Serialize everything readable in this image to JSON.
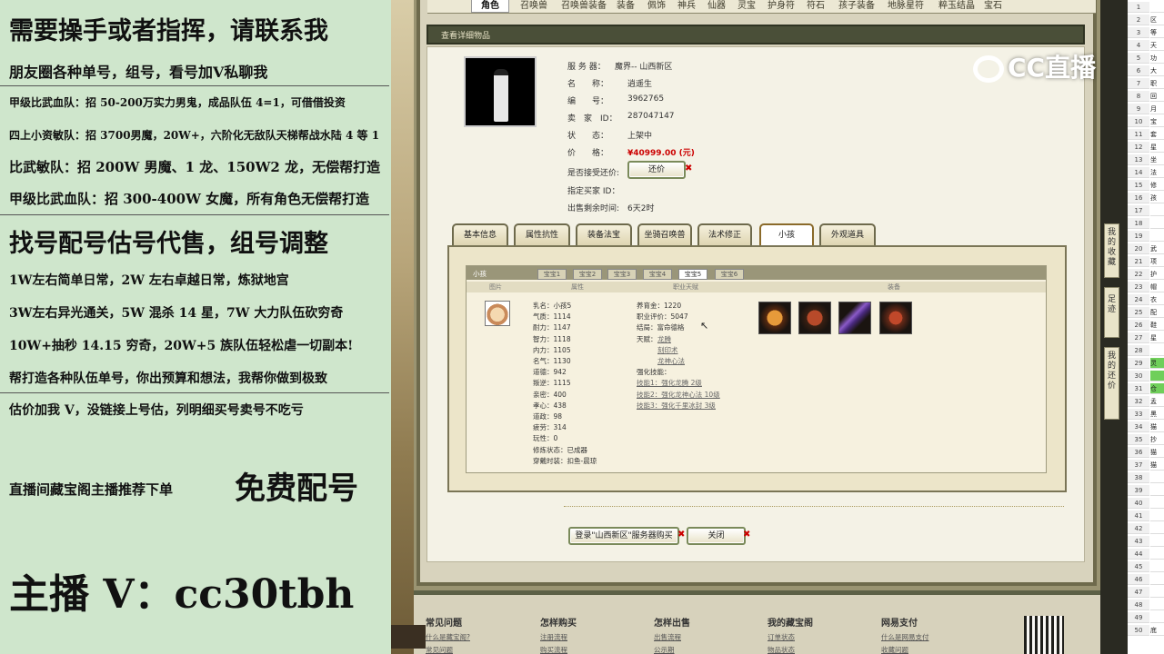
{
  "promo": {
    "line1": "需要操手或者指挥，请联系我",
    "line2": "朋友圈各种单号，组号，看号加V私聊我",
    "line3": "甲级比武血队：招 50-200万实力男鬼，成品队伍 4=1，可借借投资",
    "line4": "四上小资敏队：招 3700男魔，20W+，六阶化无敌队天梯帮战水陆 4 等 1",
    "line5": "比武敏队：招 200W 男魔、1 龙、150W2 龙，无偿帮打造",
    "line6": "甲级比武血队：招 300-400W 女魔，所有角色无偿帮打造",
    "line7": "找号配号估号代售，组号调整",
    "line8": "1W左右简单日常，2W 左右卓越日常，炼狱地宫",
    "line9": "3W左右异光通关，5W 混杀 14 星，7W 大力队伍砍穷奇",
    "line10": "10W+抽秒 14.15 穷奇，20W+5 族队伍轻松虐一切副本!",
    "line11": "帮打造各种队伍单号，你出预算和想法，我帮你做到极致",
    "line12": "估价加我 V，没链接上号估，列明细买号卖号不吃亏",
    "line13a": "直播间藏宝阁主播推荐下单",
    "line13b": "免费配号",
    "line14": "主播 V：cc30tbh"
  },
  "topTabs": [
    "角色",
    "召唤兽",
    "召唤兽装备",
    "装备",
    "佩饰",
    "神兵",
    "仙器",
    "灵宝",
    "护身符",
    "符石",
    "孩子装备",
    "地脉星符",
    "粹玉结晶",
    "宝石"
  ],
  "title": "查看详细物品",
  "watermark": "CC直播",
  "item": {
    "server_label": "服 务 器：",
    "server": "魔界-- 山西新区",
    "name_label": "名　　称：",
    "name": "逍遥生",
    "id_label": "编　　号：",
    "id": "3962765",
    "seller_label": "卖　家　ID：",
    "seller": "287047147",
    "status_label": "状　　态：",
    "status": "上架中",
    "price_label": "价　　格：",
    "price": "¥40999.00 (元)",
    "counter_label": "是否接受还价:",
    "counter_btn": "还价",
    "buyer_label": "指定买家 ID：",
    "time_label": "出售剩余时间:",
    "time": "6天2时"
  },
  "detailTabs": [
    "基本信息",
    "属性抗性",
    "装备法宝",
    "坐骑召唤兽",
    "法术修正",
    "小孩",
    "外观道具"
  ],
  "child": {
    "bar_label": "小孩",
    "subtabs": [
      "宝宝1",
      "宝宝2",
      "宝宝3",
      "宝宝4",
      "宝宝5",
      "宝宝6"
    ],
    "cols": [
      "图片",
      "属性",
      "职业天赋",
      "装备"
    ],
    "stats": [
      "乳名：小孩5",
      "气质：1114",
      "耐力：1147",
      "智力：1118",
      "内力：1105",
      "名气：1130",
      "道德：942",
      "叛逆：1115",
      "亲密：400",
      "孝心：438",
      "道政：98",
      "疲劳：314",
      "玩性：0",
      "修炼状态：已成器",
      "穿戴时装：扣鱼-晨琼"
    ],
    "right": [
      "养育金：1220",
      "职业评价：5047",
      "结局：富命德格",
      "天赋：",
      "龙腾",
      "刻印术",
      "龙神心法",
      "强化技能："
    ],
    "skills": [
      "技能1：强化龙腾 2级",
      "技能2：强化龙神心法 10级",
      "技能3：强化千里冰封 3级"
    ]
  },
  "bottom": {
    "login_btn": "登录\"山西新区\"服务器购买",
    "close_btn": "关闭"
  },
  "footer": {
    "cols": [
      {
        "h": "常见问题",
        "l1": "什么是藏宝阁?",
        "l2": "常见问题"
      },
      {
        "h": "怎样购买",
        "l1": "注册流程",
        "l2": "购买流程"
      },
      {
        "h": "怎样出售",
        "l1": "出售流程",
        "l2": "公示期"
      },
      {
        "h": "我的藏宝阁",
        "l1": "订单状态",
        "l2": "物品状态"
      },
      {
        "h": "网易支付",
        "l1": "什么是网易支付",
        "l2": "收藏问题"
      }
    ]
  },
  "sideTabs": [
    "我的收藏",
    "足迹",
    "我的还价"
  ],
  "sheet": {
    "rows": [
      "1",
      "2",
      "3",
      "4",
      "5",
      "6",
      "7",
      "8",
      "9",
      "10",
      "11",
      "12",
      "13",
      "14",
      "15",
      "16",
      "17",
      "18",
      "19",
      "20",
      "21",
      "22",
      "23",
      "24",
      "25",
      "26",
      "27",
      "28",
      "29",
      "30",
      "31",
      "32",
      "33",
      "34",
      "35",
      "36",
      "37",
      "38",
      "39",
      "40",
      "41",
      "42",
      "43",
      "44",
      "45",
      "46",
      "47",
      "48",
      "49",
      "50"
    ],
    "cells": [
      "",
      "区",
      "等",
      "天",
      "功",
      "大",
      "职",
      "回",
      "月",
      "宝",
      "套",
      "星",
      "坐",
      "法",
      "修",
      "孩",
      "",
      "",
      "",
      "武",
      "项",
      "护",
      "帽",
      "衣",
      "配",
      "鞋",
      "星",
      "",
      "灵",
      "",
      "仓",
      "孟",
      "黑",
      "猫",
      "抄",
      "猫",
      "猫",
      "",
      "",
      "",
      "",
      "",
      "",
      "",
      "",
      "",
      "",
      "",
      "",
      "底"
    ]
  },
  "colors": {
    "accent": "#6e6a4c",
    "price": "#cc0000",
    "sheetHighlight": "#6fcf5a"
  }
}
